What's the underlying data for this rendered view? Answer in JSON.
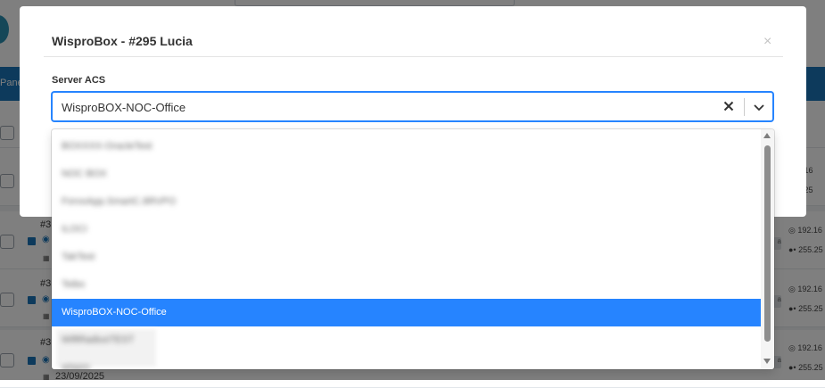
{
  "background": {
    "nav_label": "Pane",
    "rows": [
      {
        "num": "#3"
      },
      {
        "num": "#3"
      },
      {
        "num": "#3",
        "date": "23/09/2025"
      }
    ],
    "ips": [
      "192.16",
      "255.25",
      "192.16",
      "255.25",
      "192.16",
      "255.25",
      "192.16",
      "255.25"
    ]
  },
  "modal": {
    "title": "WisproBox - #295 Lucia",
    "close_glyph": "×",
    "field_label": "Server ACS",
    "selected_value": "WisproBOX-NOC-Office"
  },
  "dropdown": {
    "options": [
      {
        "label": "BOXXXX-OracleTest",
        "blurred": true,
        "selected": false
      },
      {
        "label": "NOC BOX",
        "blurred": true,
        "selected": false
      },
      {
        "label": "ForvoApp.SmartC.8RVPO",
        "blurred": true,
        "selected": false
      },
      {
        "label": "ILOCI",
        "blurred": true,
        "selected": false
      },
      {
        "label": "TakTest",
        "blurred": true,
        "selected": false
      },
      {
        "label": "Teibo",
        "blurred": true,
        "selected": false
      },
      {
        "label": "WisproBOX-NOC-Office",
        "blurred": false,
        "selected": true
      },
      {
        "label": "WiftRadiusTEST",
        "blurred": true,
        "selected": false
      },
      {
        "label": "wispro",
        "blurred": true,
        "selected": false
      }
    ]
  },
  "colors": {
    "accent": "#2684ff",
    "brand": "#1a75b8"
  },
  "icons": {
    "clear": "x-icon",
    "dropdown": "chevron-down-icon",
    "close": "close-icon"
  }
}
